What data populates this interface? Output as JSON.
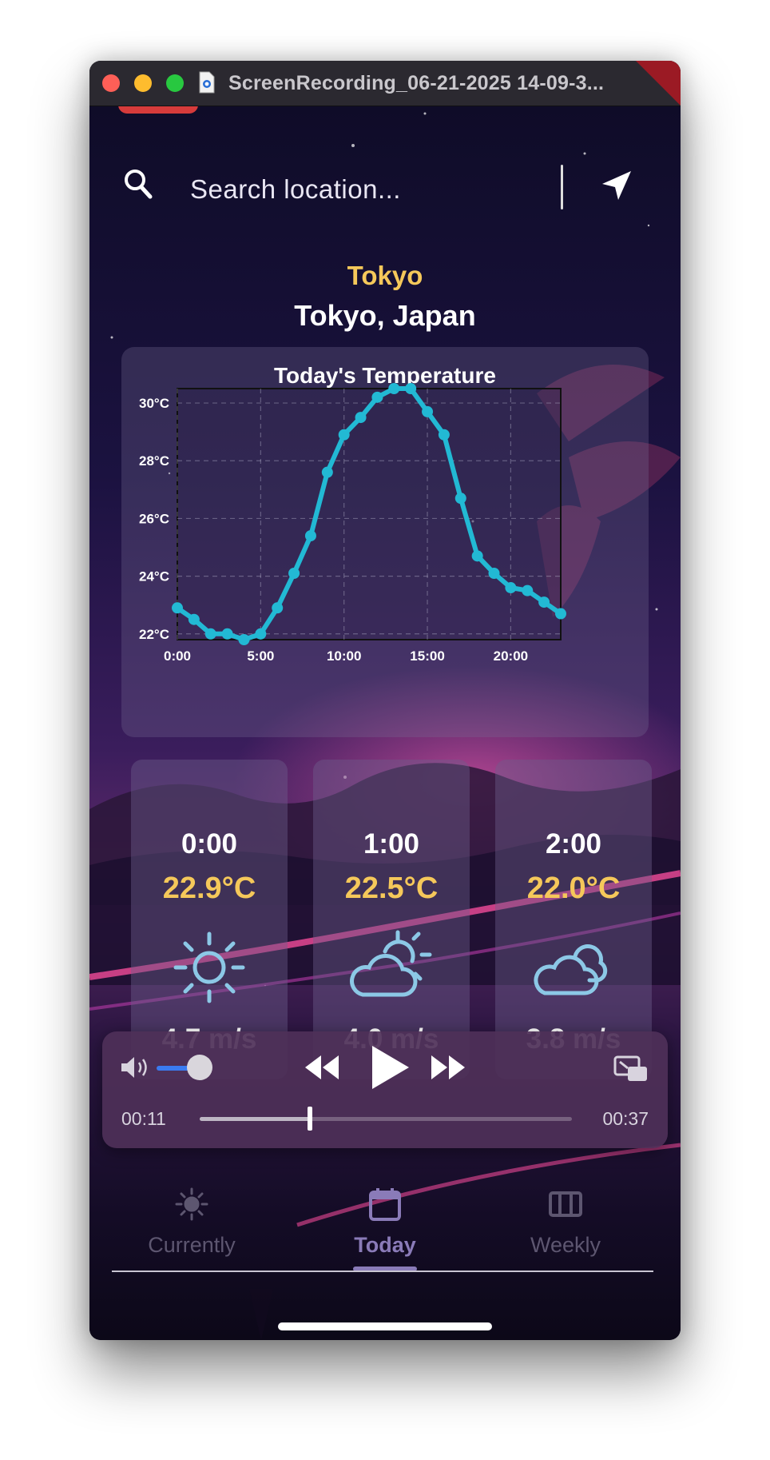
{
  "window": {
    "title": "ScreenRecording_06-21-2025 14-09-3..."
  },
  "search": {
    "placeholder": "Search location..."
  },
  "location": {
    "city": "Tokyo",
    "region": "Tokyo, Japan"
  },
  "chart_data": {
    "type": "line",
    "title": "Today's Temperature",
    "xlabel": "",
    "ylabel": "",
    "x_ticks": [
      "0:00",
      "5:00",
      "10:00",
      "15:00",
      "20:00"
    ],
    "y_ticks": [
      "22°C",
      "24°C",
      "26°C",
      "28°C",
      "30°C"
    ],
    "xlim": [
      0,
      23
    ],
    "ylim": [
      21.8,
      30.5
    ],
    "grid": true,
    "series": [
      {
        "color": "#22b9d4",
        "x": [
          0,
          1,
          2,
          3,
          4,
          5,
          6,
          7,
          8,
          9,
          10,
          11,
          12,
          13,
          14,
          15,
          16,
          17,
          18,
          19,
          20,
          21,
          22,
          23
        ],
        "y": [
          22.9,
          22.5,
          22.0,
          22.0,
          21.8,
          22.0,
          22.9,
          24.1,
          25.4,
          27.6,
          28.9,
          29.5,
          30.2,
          30.5,
          30.5,
          29.7,
          28.9,
          26.7,
          24.7,
          24.1,
          23.6,
          23.5,
          23.1,
          22.7
        ]
      }
    ]
  },
  "hourly": [
    {
      "time": "0:00",
      "temp": "22.9°C",
      "icon": "sun-icon",
      "wind": "4.7 m/s"
    },
    {
      "time": "1:00",
      "temp": "22.5°C",
      "icon": "partly-cloudy-icon",
      "wind": "4.0 m/s"
    },
    {
      "time": "2:00",
      "temp": "22.0°C",
      "icon": "cloudy-icon",
      "wind": "3.8 m/s"
    }
  ],
  "player": {
    "elapsed": "00:11",
    "duration": "00:37",
    "progress": 0.297,
    "volume": 0.8
  },
  "tabs": [
    {
      "label": "Currently",
      "icon": "sun-icon",
      "active": false
    },
    {
      "label": "Today",
      "icon": "calendar-icon",
      "active": true
    },
    {
      "label": "Weekly",
      "icon": "columns-icon",
      "active": false
    }
  ],
  "colors": {
    "accent": "#f5c85a",
    "chart_line": "#22b9d4",
    "icon": "#8cc8e6",
    "tab_active": "#8a7bb8"
  }
}
